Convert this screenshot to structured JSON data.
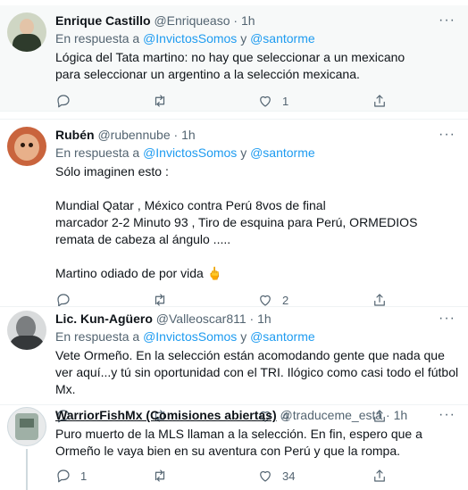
{
  "tweets": [
    {
      "name": "Enrique Castillo",
      "handle": "@Enriqueaso",
      "dot": "·",
      "time": "1h",
      "reply_prefix": "En respuesta a ",
      "mention1": "@InvictosSomos",
      "reply_and": " y ",
      "mention2": "@santorme",
      "text": "Lógica del Tata martino: no hay que seleccionar a un mexicano para seleccionar un argentino a la selección mexicana.",
      "replies": "",
      "retweets": "",
      "likes": "1"
    },
    {
      "name": "Rubén",
      "handle": "@rubennube",
      "dot": "·",
      "time": "1h",
      "reply_prefix": "En respuesta a ",
      "mention1": "@InvictosSomos",
      "reply_and": " y ",
      "mention2": "@santorme",
      "text": "Sólo imaginen esto :\n\nMundial Qatar , México contra Perú 8vos de final\nmarcador 2-2 Minuto 93 , Tiro de esquina para Perú, ORMEDIOS remata de cabeza al ángulo .....\n\nMartino odiado de por vida 🖕",
      "replies": "",
      "retweets": "",
      "likes": "2"
    },
    {
      "name": "Lic. Kun-Agüero",
      "handle": "@Valleoscar811",
      "dot": "·",
      "time": "1h",
      "reply_prefix": "En respuesta a ",
      "mention1": "@InvictosSomos",
      "reply_and": " y ",
      "mention2": "@santorme",
      "text": "Vete Ormeño. En la selección están acomodando gente que nada que ver aquí...y tú sin oportunidad con el TRI. Ilógico como casi todo el fútbol Mx.",
      "replies": "",
      "retweets": "",
      "likes": "4"
    },
    {
      "name": "WarriorFishMx (Comisiones abiertas)",
      "handle": "@traduceme_esta",
      "dot": "·",
      "time": "1h",
      "text": "Puro muerto de la MLS llaman a la selección. En fin, espero que a Ormeño le vaya bien en su aventura con Perú y que la rompa.",
      "replies": "1",
      "retweets": "",
      "likes": "34"
    }
  ],
  "more_label": "···",
  "colors": {
    "link": "#1d9bf0",
    "muted": "#536471",
    "text": "#0f1419"
  }
}
